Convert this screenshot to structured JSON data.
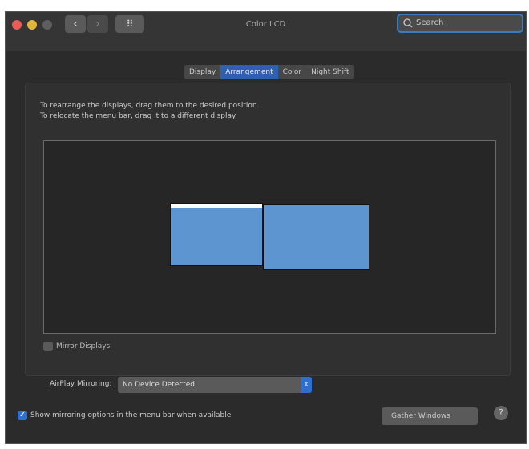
{
  "window": {
    "title": "Color LCD"
  },
  "toolbar": {
    "back": "‹",
    "forward": "›",
    "grid": "⠿",
    "search_placeholder": "Search"
  },
  "tabs": [
    {
      "label": "Display"
    },
    {
      "label": "Arrangement"
    },
    {
      "label": "Color"
    },
    {
      "label": "Night Shift"
    }
  ],
  "active_tab": "Arrangement",
  "instructions": {
    "line1": "To rearrange the displays, drag them to the desired position.",
    "line2": "To relocate the menu bar, drag it to a different display."
  },
  "mirror": {
    "label": "Mirror Displays",
    "checked": false
  },
  "airplay": {
    "label": "AirPlay Mirroring:",
    "value": "No Device Detected"
  },
  "show_options": {
    "label": "Show mirroring options in the menu bar when available",
    "checked": true
  },
  "gather": {
    "label": "Gather Windows"
  },
  "help": {
    "label": "?"
  },
  "colors": {
    "accent": "#2f6fd0",
    "display": "#5c95cf"
  }
}
